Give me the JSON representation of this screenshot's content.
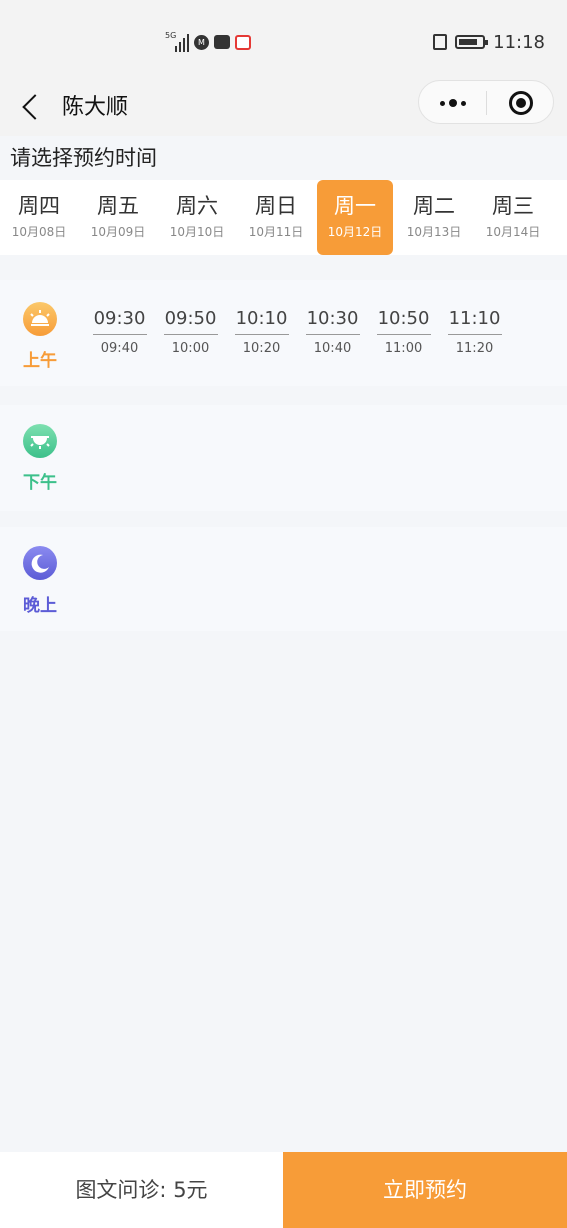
{
  "status_bar": {
    "network": "5G",
    "time": "11:18"
  },
  "nav": {
    "title": "陈大顺"
  },
  "section_title": "请选择预约时间",
  "days": [
    {
      "name": "周四",
      "date": "10月08日",
      "active": false
    },
    {
      "name": "周五",
      "date": "10月09日",
      "active": false
    },
    {
      "name": "周六",
      "date": "10月10日",
      "active": false
    },
    {
      "name": "周日",
      "date": "10月11日",
      "active": false
    },
    {
      "name": "周一",
      "date": "10月12日",
      "active": true
    },
    {
      "name": "周二",
      "date": "10月13日",
      "active": false
    },
    {
      "name": "周三",
      "date": "10月14日",
      "active": false
    }
  ],
  "periods": {
    "morning": {
      "label": "上午",
      "icon": "sunrise-icon",
      "color": "#f79c38",
      "slots": [
        {
          "start": "09:30",
          "end": "09:40"
        },
        {
          "start": "09:50",
          "end": "10:00"
        },
        {
          "start": "10:10",
          "end": "10:20"
        },
        {
          "start": "10:30",
          "end": "10:40"
        },
        {
          "start": "10:50",
          "end": "11:00"
        },
        {
          "start": "11:10",
          "end": "11:20"
        }
      ]
    },
    "afternoon": {
      "label": "下午",
      "icon": "sun-icon",
      "color": "#3cc08a"
    },
    "evening": {
      "label": "晚上",
      "icon": "moon-icon",
      "color": "#5c5cd6"
    }
  },
  "bottom": {
    "price_label": "图文问诊: 5元",
    "book_label": "立即预约"
  }
}
